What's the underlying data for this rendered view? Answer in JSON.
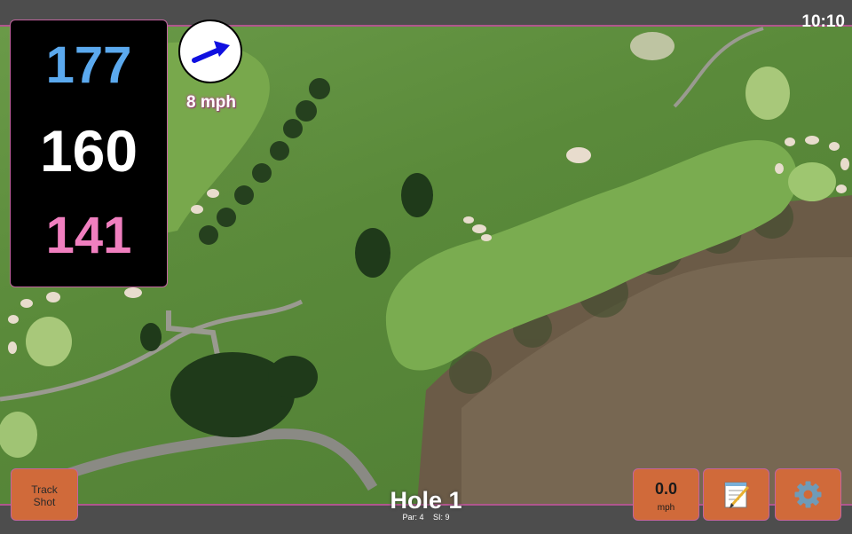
{
  "status_bar": {
    "time": "10:10"
  },
  "distances": {
    "back": "177",
    "middle": "160",
    "front": "141"
  },
  "wind": {
    "speed_label": "8 mph",
    "icon": "wind-arrow-icon"
  },
  "hole": {
    "title": "Hole 1",
    "par": "Par: 4",
    "stroke_index": "SI: 9"
  },
  "buttons": {
    "track_shot_line1": "Track",
    "track_shot_line2": "Shot",
    "speed_value": "0.0",
    "speed_unit": "mph",
    "notes_icon": "notepad-icon",
    "settings_icon": "gear-icon"
  },
  "colors": {
    "accent_border": "#b0568e",
    "button_bg": "#d06a3a",
    "back_distance": "#5ba9ee",
    "middle_distance": "#ffffff",
    "front_distance": "#f07fbf"
  }
}
